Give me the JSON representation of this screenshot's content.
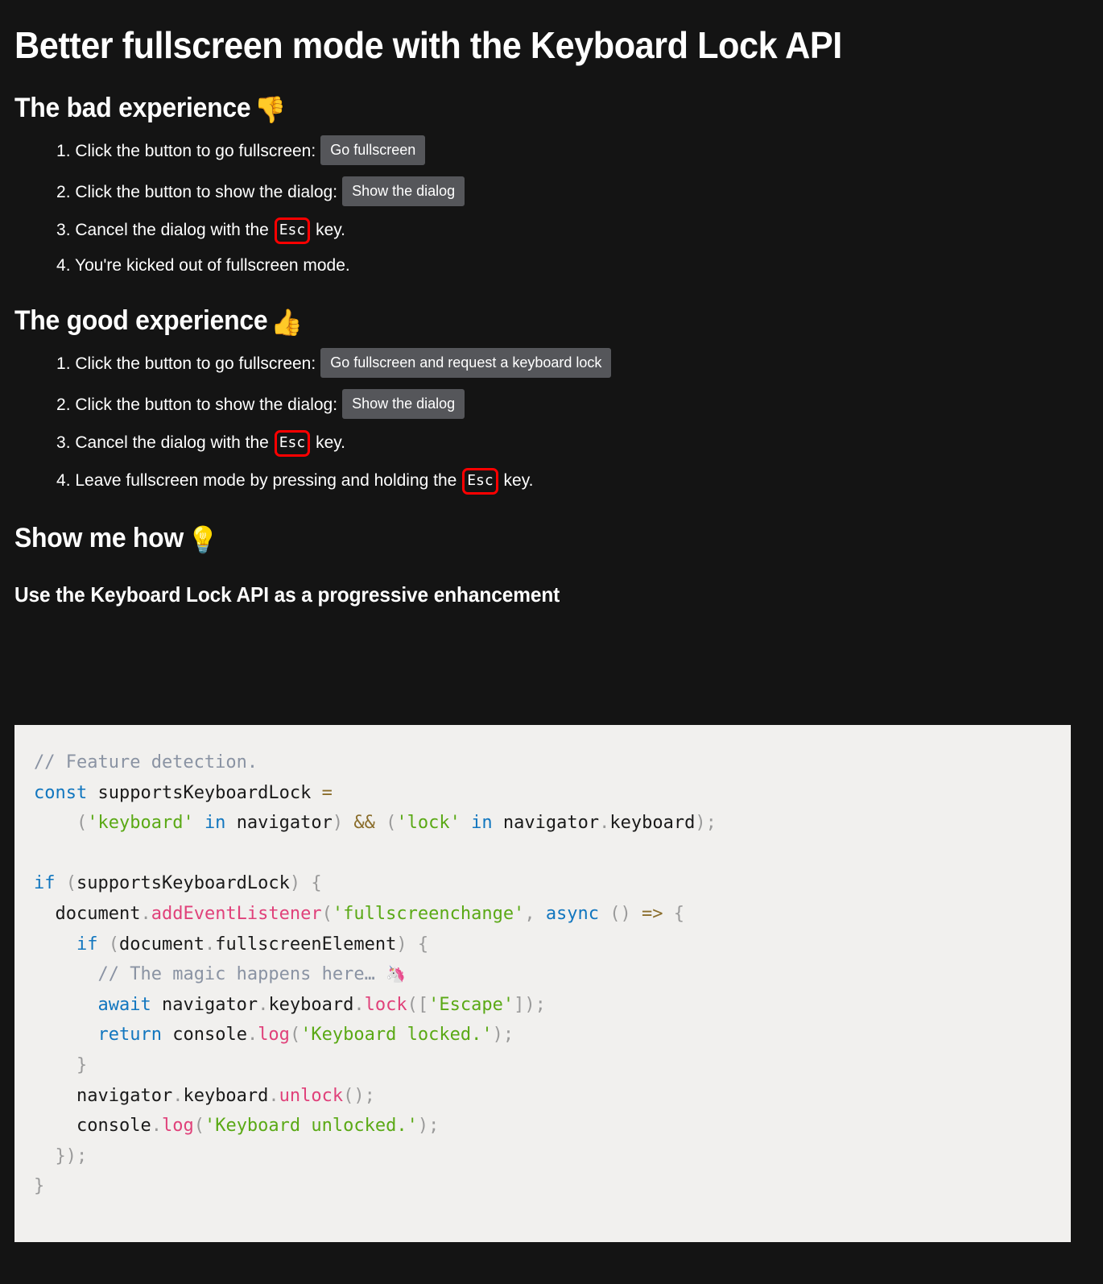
{
  "page": {
    "background_color": "#141414",
    "text_color": "#ffffff",
    "title": "Better fullscreen mode with the Keyboard Lock API"
  },
  "sections": {
    "bad": {
      "heading": "The bad experience",
      "heading_emoji": "👎",
      "heading_emoji_name": "thumbs-down-emoji",
      "steps": [
        {
          "text": "Click the button to go fullscreen:",
          "button": "Go fullscreen"
        },
        {
          "text": "Click the button to show the dialog:",
          "button": "Show the dialog"
        },
        {
          "text_before": "Cancel the dialog with the",
          "kbd": "Esc",
          "text_after": "key."
        },
        {
          "text": "You're kicked out of fullscreen mode."
        }
      ]
    },
    "good": {
      "heading": "The good experience",
      "heading_emoji": "👍",
      "heading_emoji_name": "thumbs-up-emoji",
      "steps": [
        {
          "text": "Click the button to go fullscreen:",
          "button": "Go fullscreen and request a keyboard lock"
        },
        {
          "text": "Click the button to show the dialog:",
          "button": "Show the dialog"
        },
        {
          "text_before": "Cancel the dialog with the",
          "kbd": "Esc",
          "text_after": "key."
        },
        {
          "text_before": "Leave fullscreen mode by pressing and holding the",
          "kbd": "Esc",
          "text_after": "key."
        }
      ]
    },
    "how": {
      "heading": "Show me how",
      "heading_emoji": "💡",
      "heading_emoji_name": "lightbulb-emoji",
      "subheading": "Use the Keyboard Lock API as a progressive enhancement"
    }
  },
  "code": {
    "language": "javascript",
    "background_color": "#f1f0ee",
    "colors": {
      "comment": "#8a93a3",
      "keyword": "#1176bf",
      "string": "#5aa915",
      "operator": "#8a6d2b",
      "function": "#e0417a",
      "punctuation": "#9a9a9a",
      "plain": "#1a1a1a"
    },
    "inline_emoji": "🦄",
    "text": "// Feature detection.\nconst supportsKeyboardLock =\n    ('keyboard' in navigator) && ('lock' in navigator.keyboard);\n\nif (supportsKeyboardLock) {\n  document.addEventListener('fullscreenchange', async () => {\n    if (document.fullscreenElement) {\n      // The magic happens here… 🦄\n      await navigator.keyboard.lock(['Escape']);\n      return console.log('Keyboard locked.');\n    }\n    navigator.keyboard.unlock();\n    console.log('Keyboard unlocked.');\n  });\n}"
  },
  "kbd_style": {
    "border_color": "#ff0000",
    "border_width": "3px"
  },
  "button_style": {
    "background": "#55565a",
    "text_color": "#ffffff"
  }
}
